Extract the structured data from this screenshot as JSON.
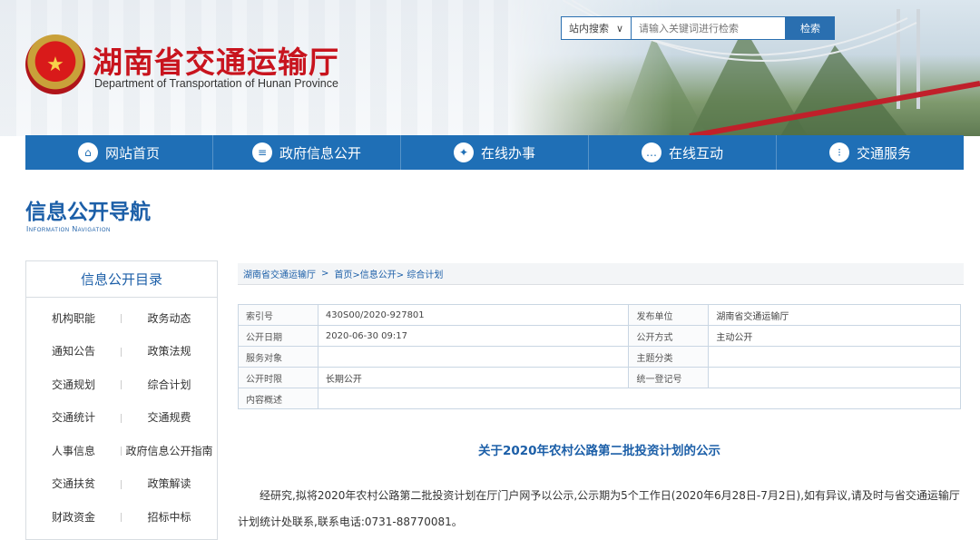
{
  "site": {
    "title": "湖南省交通运输厅",
    "subtitle": "Department of Transportation of Hunan Province"
  },
  "search": {
    "scope": "站内搜索",
    "placeholder": "请输入关键词进行检索",
    "button": "检索"
  },
  "nav": {
    "items": [
      {
        "label": "网站首页",
        "icon": "home-icon"
      },
      {
        "label": "政府信息公开",
        "icon": "document-icon"
      },
      {
        "label": "在线办事",
        "icon": "handshake-icon"
      },
      {
        "label": "在线互动",
        "icon": "chat-icon"
      },
      {
        "label": "交通服务",
        "icon": "service-icon"
      }
    ]
  },
  "section": {
    "title": "信息公开导航",
    "subtitle": "Information Navigation"
  },
  "sidebar": {
    "heading": "信息公开目录",
    "links": [
      "机构职能",
      "政务动态",
      "通知公告",
      "政策法规",
      "交通规划",
      "综合计划",
      "交通统计",
      "交通规费",
      "人事信息",
      "政府信息公开指南",
      "交通扶贫",
      "政策解读",
      "财政资金",
      "招标中标"
    ]
  },
  "breadcrumb": {
    "root": "湖南省交通运输厅",
    "sep": ">",
    "path": "首页>信息公开> 综合计划"
  },
  "meta": {
    "rows": [
      {
        "k1": "索引号",
        "v1": "430S00/2020-927801",
        "k2": "发布单位",
        "v2": "湖南省交通运输厅"
      },
      {
        "k1": "公开日期",
        "v1": "2020-06-30 09:17",
        "k2": "公开方式",
        "v2": "主动公开"
      },
      {
        "k1": "服务对象",
        "v1": "",
        "k2": "主题分类",
        "v2": ""
      },
      {
        "k1": "公开时限",
        "v1": "长期公开",
        "k2": "统一登记号",
        "v2": ""
      },
      {
        "k1": "内容概述",
        "v1": ""
      }
    ]
  },
  "article": {
    "title": "关于2020年农村公路第二批投资计划的公示",
    "body": "经研究,拟将2020年农村公路第二批投资计划在厅门户网予以公示,公示期为5个工作日(2020年6月28日-7月2日),如有异议,请及时与省交通运输厅计划统计处联系,联系电话:0731-88770081。"
  },
  "colors": {
    "nav_bg": "#1f6fb6",
    "title_red": "#c8141e",
    "link_blue": "#1c5fa8"
  }
}
